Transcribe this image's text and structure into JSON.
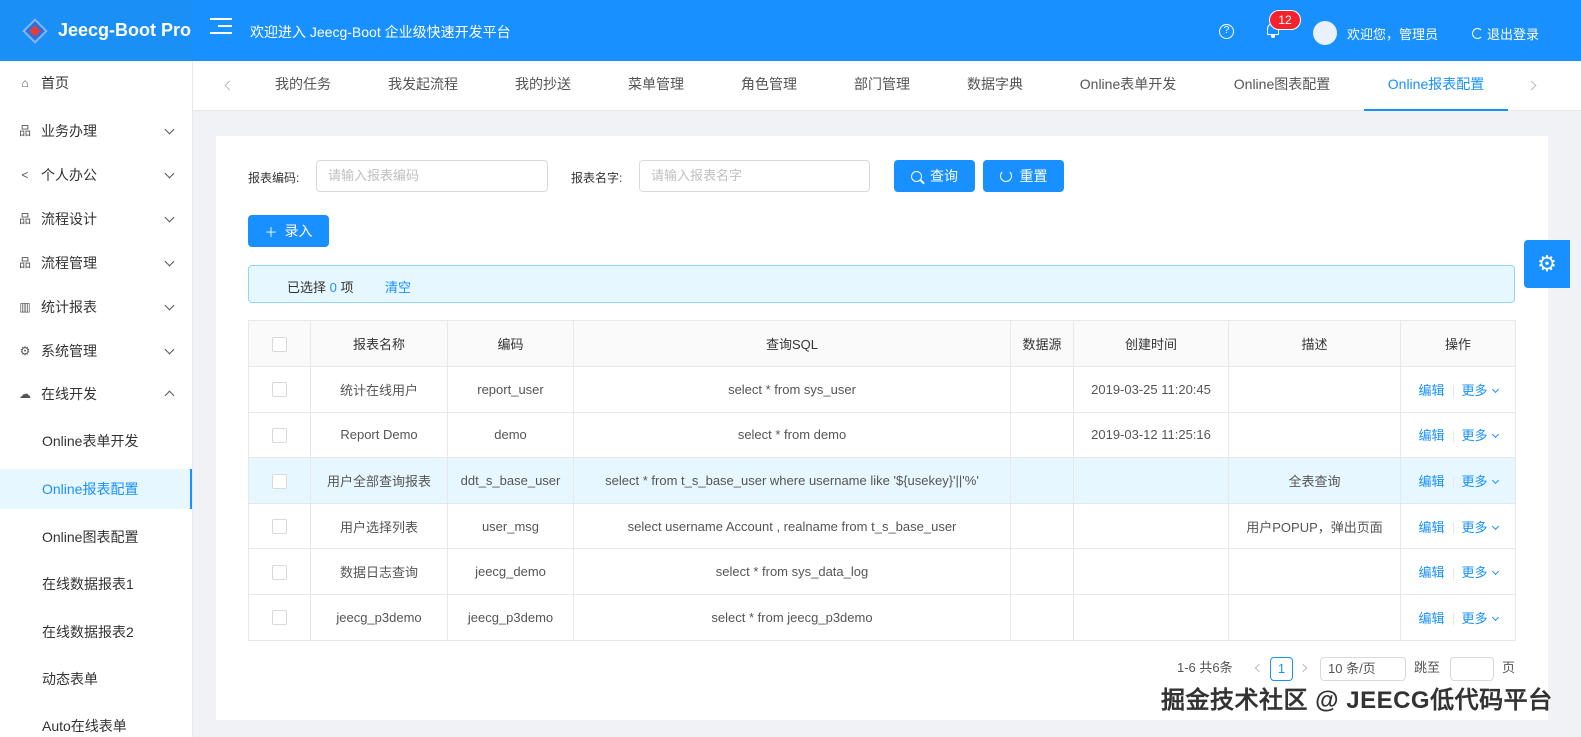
{
  "header": {
    "logo_text": "Jeecg-Boot Pro",
    "title": "欢迎进入 Jeecg-Boot 企业级快速开发平台",
    "notification_count": "12",
    "welcome": "欢迎您，管理员",
    "logout": "退出登录"
  },
  "sidebar": {
    "items": [
      {
        "label": "首页",
        "icon": "home-icon"
      },
      {
        "label": "业务办理",
        "icon": "sitemap-icon"
      },
      {
        "label": "个人办公",
        "icon": "share-icon"
      },
      {
        "label": "流程设计",
        "icon": "sitemap-icon"
      },
      {
        "label": "流程管理",
        "icon": "sitemap-icon"
      },
      {
        "label": "统计报表",
        "icon": "bar-chart-icon"
      },
      {
        "label": "系统管理",
        "icon": "gear-icon"
      },
      {
        "label": "在线开发",
        "icon": "cloud-icon"
      }
    ],
    "sub_items": [
      {
        "label": "Online表单开发"
      },
      {
        "label": "Online报表配置"
      },
      {
        "label": "Online图表配置"
      },
      {
        "label": "在线数据报表1"
      },
      {
        "label": "在线数据报表2"
      },
      {
        "label": "动态表单"
      },
      {
        "label": "Auto在线表单"
      }
    ]
  },
  "tabs": [
    {
      "label": "我的任务"
    },
    {
      "label": "我发起流程"
    },
    {
      "label": "我的抄送"
    },
    {
      "label": "菜单管理"
    },
    {
      "label": "角色管理"
    },
    {
      "label": "部门管理"
    },
    {
      "label": "数据字典"
    },
    {
      "label": "Online表单开发"
    },
    {
      "label": "Online图表配置"
    },
    {
      "label": "Online报表配置"
    }
  ],
  "search": {
    "code_label": "报表编码:",
    "code_placeholder": "请输入报表编码",
    "name_label": "报表名字:",
    "name_placeholder": "请输入报表名字",
    "query_button": "查询",
    "reset_button": "重置",
    "add_button": "录入"
  },
  "selection": {
    "prefix": "已选择",
    "count": "0",
    "suffix": "项",
    "clear": "清空"
  },
  "table": {
    "headers": [
      "报表名称",
      "编码",
      "查询SQL",
      "数据源",
      "创建时间",
      "描述",
      "操作"
    ],
    "rows": [
      {
        "name": "统计在线用户",
        "code": "report_user",
        "sql": "select * from sys_user",
        "datasource": "",
        "created": "2019-03-25 11:20:45",
        "desc": "",
        "edit": "编辑",
        "more": "更多"
      },
      {
        "name": "Report Demo",
        "code": "demo",
        "sql": "select * from demo",
        "datasource": "",
        "created": "2019-03-12 11:25:16",
        "desc": "",
        "edit": "编辑",
        "more": "更多"
      },
      {
        "name": "用户全部查询报表",
        "code": "ddt_s_base_user",
        "sql": "select * from t_s_base_user where username like '${usekey}'||'%'",
        "datasource": "",
        "created": "",
        "desc": "全表查询",
        "edit": "编辑",
        "more": "更多"
      },
      {
        "name": "用户选择列表",
        "code": "user_msg",
        "sql": "select username Account , realname from t_s_base_user",
        "datasource": "",
        "created": "",
        "desc": "用户POPUP，弹出页面",
        "edit": "编辑",
        "more": "更多"
      },
      {
        "name": "数据日志查询",
        "code": "jeecg_demo",
        "sql": "select * from sys_data_log",
        "datasource": "",
        "created": "",
        "desc": "",
        "edit": "编辑",
        "more": "更多"
      },
      {
        "name": "jeecg_p3demo",
        "code": "jeecg_p3demo",
        "sql": "select * from jeecg_p3demo",
        "datasource": "",
        "created": "",
        "desc": "",
        "edit": "编辑",
        "more": "更多"
      }
    ]
  },
  "pagination": {
    "total": "1-6 共6条",
    "current": "1",
    "page_size": "10 条/页",
    "jump_label": "跳至",
    "page_suffix": "页"
  },
  "watermark": "掘金技术社区 @ JEECG低代码平台",
  "colors": {
    "primary": "#1890ff",
    "highlight_row": "#e6f7ff"
  }
}
